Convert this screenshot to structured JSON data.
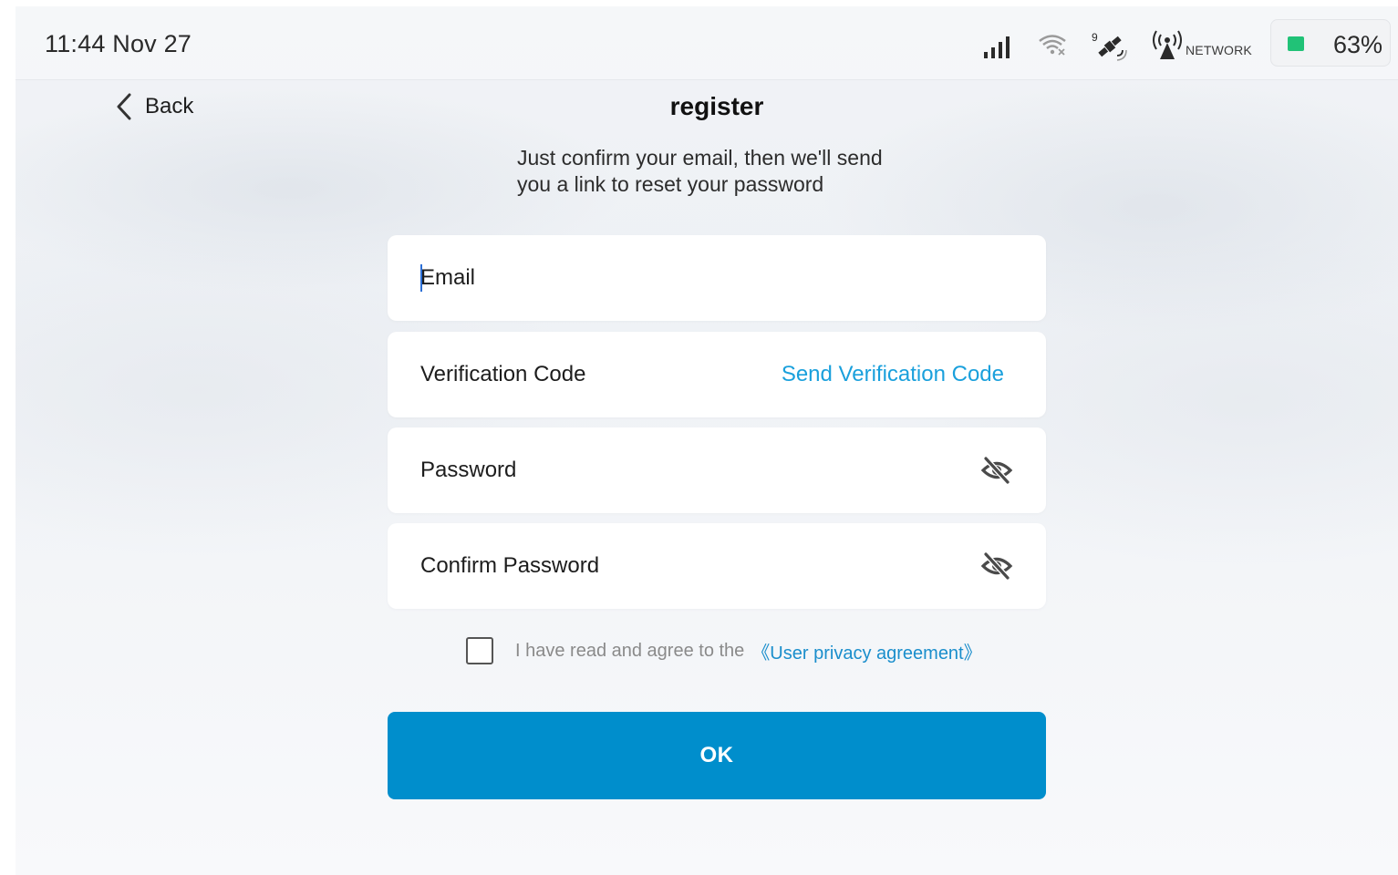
{
  "status_bar": {
    "time": "11:44 Nov 27",
    "network_label": "NETWORK",
    "battery": "63%",
    "battery_level": 0.63,
    "satellite_count": "9",
    "icons": [
      "signal-icon",
      "wifi-icon",
      "satellite-icon",
      "network-antenna-icon",
      "battery-icon"
    ],
    "battery_color": "#21c277"
  },
  "header": {
    "back_label": "Back",
    "title": "register"
  },
  "subtitle": {
    "line1": "Just confirm your email, then we'll send",
    "line2": "you a link to reset your password"
  },
  "form": {
    "email": {
      "placeholder": "Email",
      "value": ""
    },
    "verification_code": {
      "placeholder": "Verification Code",
      "value": "",
      "send_label": "Send Verification Code"
    },
    "password": {
      "placeholder": "Password",
      "value": "",
      "toggle_icon": "eye-off-icon"
    },
    "confirm_password": {
      "placeholder": "Confirm Password",
      "value": "",
      "toggle_icon": "eye-off-icon"
    }
  },
  "agreement": {
    "checked": false,
    "text": "I have read and agree to the",
    "link": "《User privacy agreement》"
  },
  "ok_button": {
    "label": "OK"
  },
  "colors": {
    "accent": "#008ecc",
    "link": "#1aa0dc"
  }
}
